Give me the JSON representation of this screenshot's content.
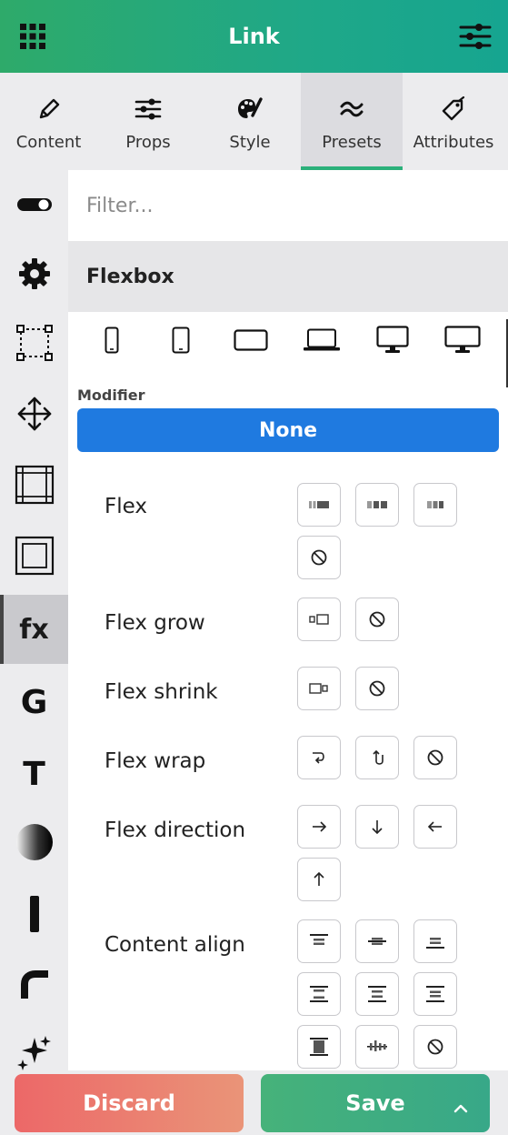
{
  "header": {
    "title": "Link",
    "left_icon": "grid-icon",
    "right_icon": "sliders-icon"
  },
  "tabs": [
    {
      "label": "Content",
      "icon": "pencil-icon"
    },
    {
      "label": "Props",
      "icon": "sliders-icon"
    },
    {
      "label": "Style",
      "icon": "palette-icon"
    },
    {
      "label": "Presets",
      "icon": "wave-icon",
      "active": true
    },
    {
      "label": "Attributes",
      "icon": "tag-icon"
    }
  ],
  "sidebar": {
    "items": [
      {
        "name": "toggle-icon"
      },
      {
        "name": "gear-icon"
      },
      {
        "name": "selection-box-icon"
      },
      {
        "name": "move-arrows-icon"
      },
      {
        "name": "frame-icon"
      },
      {
        "name": "inner-square-icon"
      },
      {
        "name": "fx-icon",
        "text": "fx",
        "active": true
      },
      {
        "name": "g-icon",
        "text": "G"
      },
      {
        "name": "t-icon",
        "text": "T"
      },
      {
        "name": "gradient-circle-icon"
      },
      {
        "name": "border-line-icon"
      },
      {
        "name": "corner-radius-icon"
      },
      {
        "name": "sparkle-icon"
      }
    ]
  },
  "filter": {
    "placeholder": "Filter..."
  },
  "section": {
    "title": "Flexbox"
  },
  "devices": [
    "phone-icon",
    "tablet-icon",
    "tablet-landscape-icon",
    "laptop-icon",
    "desktop-icon",
    "wide-desktop-icon"
  ],
  "modifier": {
    "label": "Modifier",
    "value": "None"
  },
  "properties": [
    {
      "label": "Flex",
      "options": [
        "flex-1-icon",
        "flex-auto-icon",
        "flex-initial-icon",
        "none-icon"
      ]
    },
    {
      "label": "Flex grow",
      "options": [
        "grow-icon",
        "none-icon"
      ]
    },
    {
      "label": "Flex shrink",
      "options": [
        "shrink-icon",
        "none-icon"
      ]
    },
    {
      "label": "Flex wrap",
      "options": [
        "wrap-icon",
        "wrap-reverse-icon",
        "none-icon"
      ]
    },
    {
      "label": "Flex direction",
      "options": [
        "arrow-right-icon",
        "arrow-down-icon",
        "arrow-left-icon",
        "arrow-up-icon"
      ]
    },
    {
      "label": "Content align",
      "options": [
        "align-start-icon",
        "align-center-icon",
        "align-end-icon",
        "align-between-icon",
        "align-around-icon",
        "align-evenly-icon",
        "align-stretch-icon",
        "align-baseline-icon",
        "none-icon"
      ]
    }
  ],
  "footer": {
    "discard_label": "Discard",
    "save_label": "Save"
  },
  "colors": {
    "header": "#1fa888",
    "modifier": "#1f7ae0",
    "discard": "#ec6868",
    "save": "#46b27a",
    "active_tab": "#2bb07a"
  }
}
